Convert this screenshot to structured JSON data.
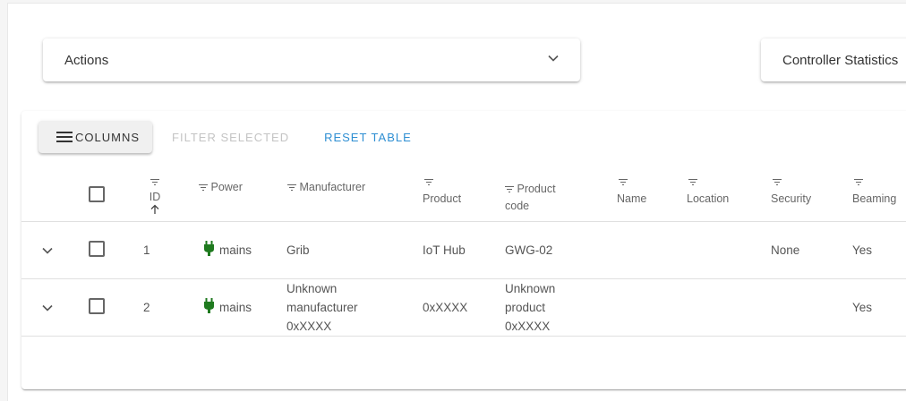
{
  "actions_panel": {
    "title": "Actions"
  },
  "stats_panel": {
    "title": "Controller Statistics"
  },
  "toolbar": {
    "columns_label": "COLUMNS",
    "filter_selected_label": "FILTER SELECTED",
    "reset_table_label": "RESET TABLE"
  },
  "columns": {
    "id": "ID",
    "power": "Power",
    "manufacturer": "Manufacturer",
    "product": "Product",
    "product_code_line1": "Product",
    "product_code_line2": "code",
    "name": "Name",
    "location": "Location",
    "security": "Security",
    "beaming": "Beaming"
  },
  "sort": {
    "column": "ID",
    "direction": "ascending"
  },
  "rows": [
    {
      "id": "1",
      "power": "mains",
      "manufacturer": [
        "Grib"
      ],
      "product": "IoT Hub",
      "product_code": [
        "GWG-02"
      ],
      "name": "",
      "location": "",
      "security": "None",
      "beaming": "Yes"
    },
    {
      "id": "2",
      "power": "mains",
      "manufacturer": [
        "Unknown",
        "manufacturer",
        "0xXXXX"
      ],
      "product": "0xXXXX",
      "product_code": [
        "Unknown",
        "product",
        "0xXXXX"
      ],
      "name": "",
      "location": "",
      "security": "",
      "beaming": "Yes"
    }
  ],
  "colors": {
    "accent": "#2f8fd3",
    "plug": "#1f7a1f",
    "disabled_text": "#c4c4c4"
  },
  "icons": {
    "panel_chevron": "chevron-down-icon",
    "columns_menu": "menu-icon",
    "header_filter": "filter-icon",
    "sort": "arrow-up-icon",
    "row_expand": "chevron-down-icon",
    "power": "plug-icon"
  }
}
